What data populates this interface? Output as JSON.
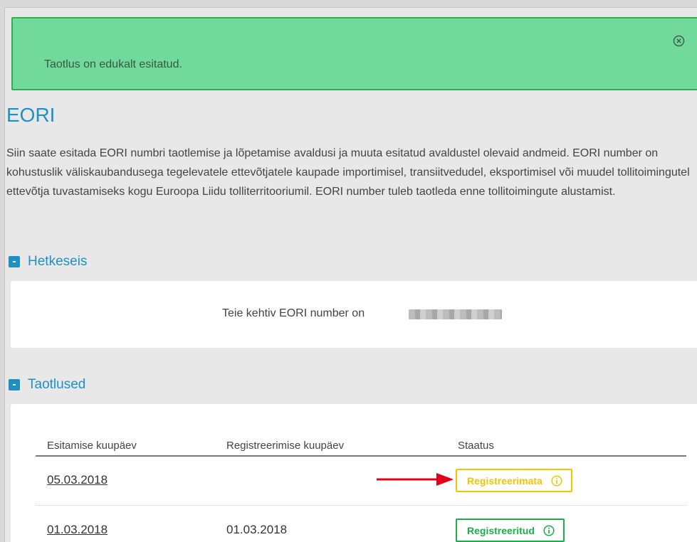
{
  "alert": {
    "message": "Taotlus on edukalt esitatud.",
    "color": "#72d99d"
  },
  "page_title": "EORI",
  "intro": "Siin saate esitada EORI numbri taotlemise ja lõpetamise avaldusi ja muuta esitatud avaldustel olevaid andmeid. EORI number on kohustuslik väliskaubandusega tegelevatele ettevõtjatele kaupade importimisel, transiitvedudel, eksportimisel või muudel tollitoimingutel ettevõtja tuvastamiseks kogu Euroopa Liidu tolliterritooriumil. EORI number tuleb taotleda enne tollitoimingute alustamist.",
  "sections": {
    "current": {
      "toggle": "-",
      "label": "Hetkeseis",
      "text": "Teie kehtiv EORI number on"
    },
    "applications": {
      "toggle": "-",
      "label": "Taotlused",
      "columns": [
        "Esitamise kuupäev",
        "Registreerimise kuupäev",
        "Staatus"
      ],
      "rows": [
        {
          "submitted": "05.03.2018",
          "registered": "",
          "status": "Registreerimata",
          "status_color": "#f3c400"
        },
        {
          "submitted": "01.03.2018",
          "registered": "01.03.2018",
          "status": "Registreeritud",
          "status_color": "#19b04a"
        }
      ]
    }
  },
  "colors": {
    "accent": "#1f8fc4",
    "arrow": "#e3001b"
  }
}
